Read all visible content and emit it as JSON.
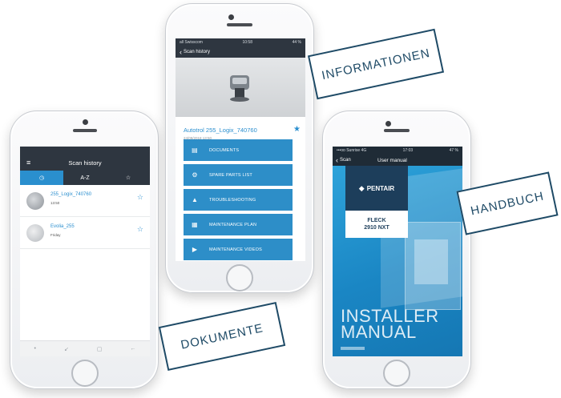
{
  "center_phone": {
    "status": {
      "carrier": "all Swisscom",
      "time": "10:58",
      "battery": "44 %"
    },
    "nav": {
      "back_label": "Scan history"
    },
    "product": {
      "title": "Autotrol 255_Logix_740760",
      "date": "24/09/2018 13:50"
    },
    "menu": [
      {
        "label": "DOCUMENTS",
        "icon": "document-icon"
      },
      {
        "label": "SPARE PARTS LIST",
        "icon": "gears-icon"
      },
      {
        "label": "TROUBLESHOOTING",
        "icon": "warning-icon"
      },
      {
        "label": "MAINTENANCE PLAN",
        "icon": "calendar-icon"
      },
      {
        "label": "MAINTENANCE VIDEOS",
        "icon": "play-icon"
      }
    ]
  },
  "left_phone": {
    "nav": {
      "title": "Scan history"
    },
    "tabs": [
      {
        "label": "◷",
        "active": true
      },
      {
        "label": "A-Z",
        "active": false
      },
      {
        "label": "☆",
        "active": false
      }
    ],
    "history": [
      {
        "title": "255_Logix_740760",
        "subtitle": "13:50"
      },
      {
        "title": "Evolia_255",
        "subtitle": "Friday"
      }
    ],
    "bottom_nav": [
      "•",
      "↙",
      "▢",
      "←"
    ]
  },
  "right_phone": {
    "status": {
      "carrier": "•••oo Sunrise 4G",
      "time": "17:03",
      "battery": "47 %"
    },
    "nav": {
      "back_label": "Scan",
      "title": "User manual"
    },
    "manual": {
      "brand": "PENTAIR",
      "model_line1": "FLECK",
      "model_line2": "2910 NXT",
      "cover_title_line1": "INSTALLER",
      "cover_title_line2": "MANUAL"
    }
  },
  "labels": {
    "informationen": "INFORMATIONEN",
    "dokumente": "DOKUMENTE",
    "handbuch": "HANDBUCH"
  },
  "colors": {
    "accent_blue": "#2b8fcf",
    "dark_bar": "#2e3640",
    "label_border": "#1e4a66"
  }
}
